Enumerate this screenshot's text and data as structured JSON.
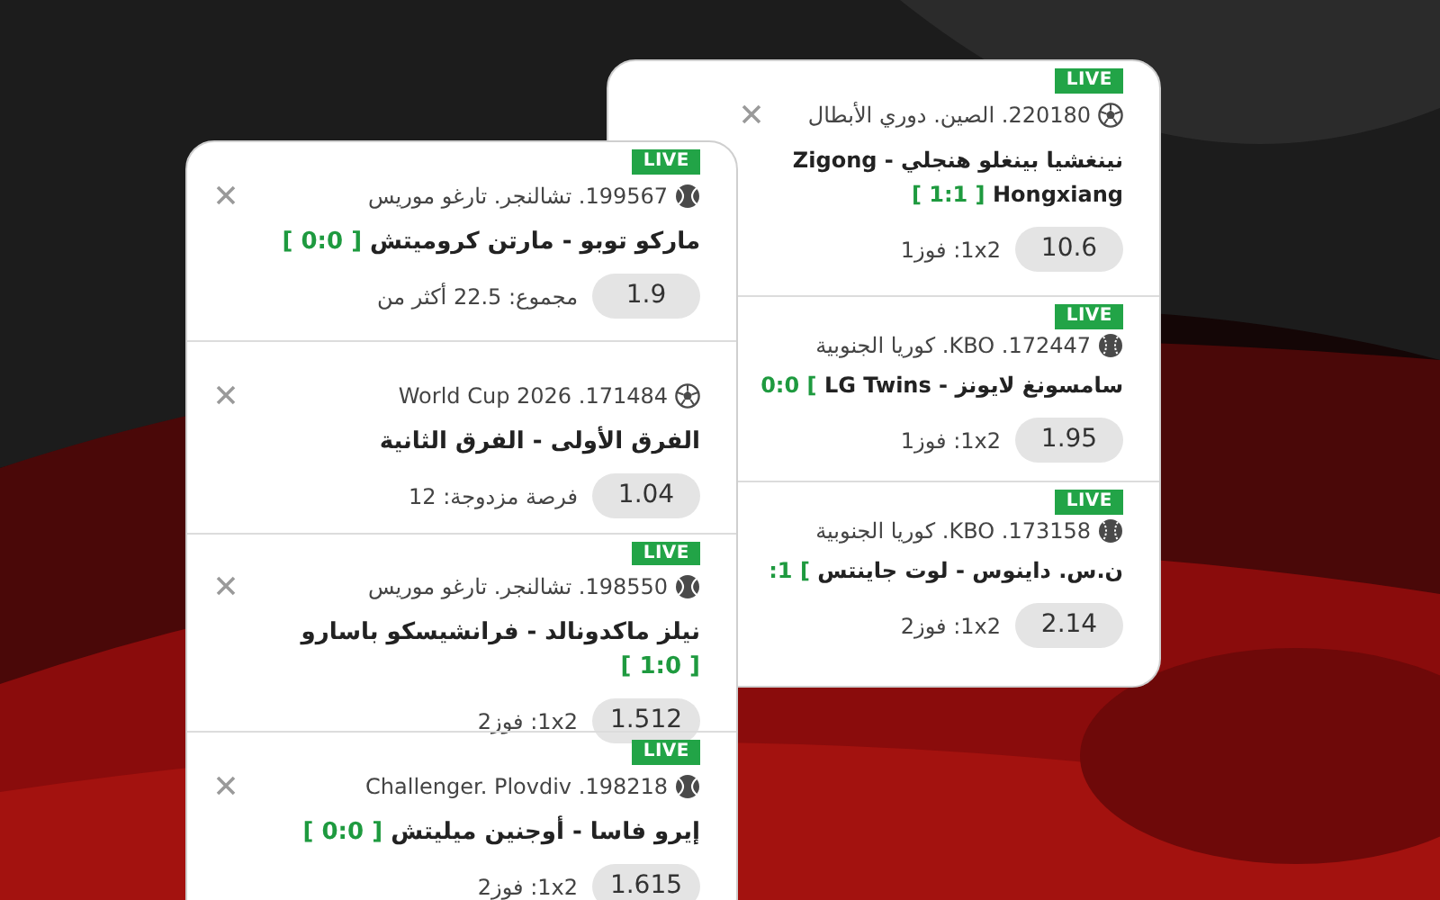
{
  "back_card": {
    "rows": [
      {
        "live": true,
        "live_badge": "LIVE",
        "closable": true,
        "kind": "soccer",
        "league": "220180. الصين. دوري الأبطال",
        "title": "نينغشيا بينغلو هنجلي - Zigong Hongxiang",
        "score": "[ 1:1 ]",
        "odds": "10.6",
        "market": "1x2: فوز1"
      },
      {
        "live": true,
        "live_badge": "LIVE",
        "closable": false,
        "kind": "baseball",
        "league": "172447. KBO. كوريا الجنوبية",
        "title": "سامسونغ لايونز - LG Twins",
        "score": "0:0 [",
        "odds": "1.95",
        "market": "1x2: فوز1"
      },
      {
        "live": true,
        "live_badge": "LIVE",
        "closable": false,
        "kind": "baseball",
        "league": "173158. KBO. كوريا الجنوبية",
        "title": "ن.س. داينوس - لوت جاينتس",
        "score": ":1 [",
        "odds": "2.14",
        "market": "1x2: فوز2"
      }
    ]
  },
  "front_card": {
    "rows": [
      {
        "live": true,
        "live_badge": "LIVE",
        "closable": true,
        "kind": "tennis",
        "league": "199567. تشالنجر. تارغو موريس",
        "title": "ماركو توبو - مارتن كروميتش",
        "score": "[ 0:0 ]",
        "odds": "1.9",
        "market": "مجموع: 22.5 أكثر من"
      },
      {
        "live": false,
        "closable": true,
        "kind": "soccer",
        "league": "171484. World Cup 2026",
        "title": "الفرق الأولى - الفرق الثانية",
        "odds": "1.04",
        "market": "فرصة مزدوجة: 12"
      },
      {
        "live": true,
        "live_badge": "LIVE",
        "closable": true,
        "kind": "tennis",
        "league": "198550. تشالنجر. تارغو موريس",
        "title": "نيلز ماكدونالد - فرانشيسكو باسارو",
        "score": "[ 1:0 ]",
        "odds": "1.512",
        "market": "1x2: فوز2"
      },
      {
        "live": true,
        "live_badge": "LIVE",
        "closable": true,
        "kind": "tennis",
        "league": "198218. Challenger. Plovdiv",
        "title": "إيرو فاسا - أوجنين ميليتش",
        "score": "[ 0:0 ]",
        "odds": "1.615",
        "market": "1x2: فوز2"
      }
    ]
  }
}
